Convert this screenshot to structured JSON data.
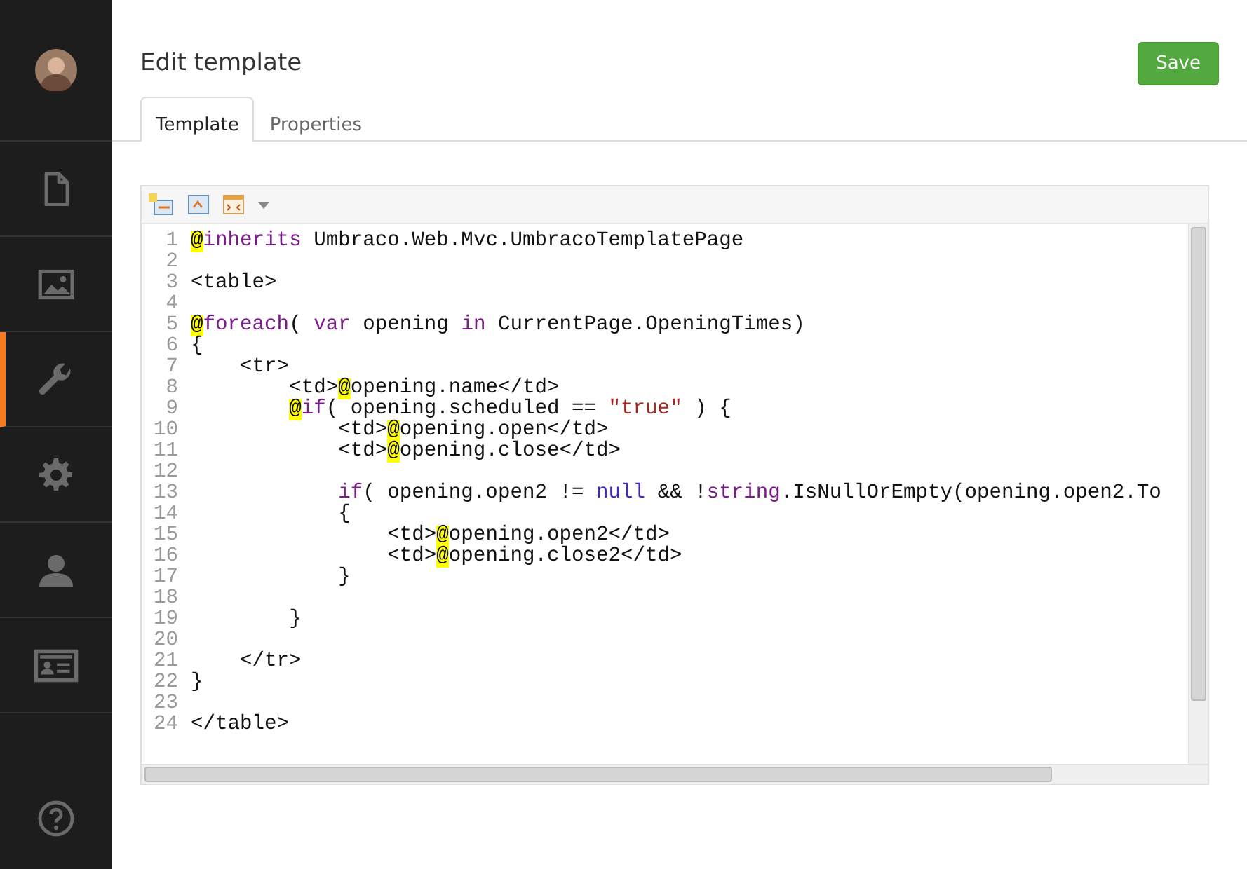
{
  "sidebar": {
    "sections": [
      {
        "kind": "content",
        "selected": false
      },
      {
        "kind": "media",
        "selected": false
      },
      {
        "kind": "settings",
        "selected": true
      },
      {
        "kind": "developer",
        "selected": false
      },
      {
        "kind": "users",
        "selected": false
      },
      {
        "kind": "members",
        "selected": false
      }
    ]
  },
  "header": {
    "title": "Edit template",
    "save_button": "Save"
  },
  "tabs": [
    {
      "label": "Template",
      "selected": true
    },
    {
      "label": "Properties",
      "selected": false
    }
  ],
  "editor": {
    "lines": [
      {
        "number": "1",
        "tokens": [
          {
            "kind": "at",
            "text": "@"
          },
          {
            "kind": "keyword",
            "text": "inherits"
          },
          {
            "kind": "plain",
            "text": " Umbraco.Web.Mvc.UmbracoTemplatePage"
          }
        ]
      },
      {
        "number": "2"
      },
      {
        "number": "3",
        "tokens": [
          {
            "kind": "plain",
            "text": "<table>"
          }
        ]
      },
      {
        "number": "4"
      },
      {
        "number": "5",
        "tokens": [
          {
            "kind": "at",
            "text": "@"
          },
          {
            "kind": "keyword",
            "text": "foreach"
          },
          {
            "kind": "plain",
            "text": "( "
          },
          {
            "kind": "keyword",
            "text": "var"
          },
          {
            "kind": "plain",
            "text": " opening "
          },
          {
            "kind": "keyword",
            "text": "in"
          },
          {
            "kind": "plain",
            "text": " CurrentPage.OpeningTimes)"
          }
        ]
      },
      {
        "number": "6",
        "tokens": [
          {
            "kind": "plain",
            "text": "{"
          }
        ]
      },
      {
        "number": "7",
        "tokens": [
          {
            "kind": "plain",
            "text": "    <tr>"
          }
        ]
      },
      {
        "number": "8",
        "tokens": [
          {
            "kind": "plain",
            "text": "        <td>"
          },
          {
            "kind": "at",
            "text": "@"
          },
          {
            "kind": "plain",
            "text": "opening.name</td>"
          }
        ]
      },
      {
        "number": "9",
        "tokens": [
          {
            "kind": "at",
            "text": "        @"
          },
          {
            "kind": "keyword",
            "text": "if"
          },
          {
            "kind": "plain",
            "text": "( opening.scheduled == "
          },
          {
            "kind": "string",
            "text": "\"true\""
          },
          {
            "kind": "plain",
            "text": " ) {"
          }
        ]
      },
      {
        "number": "10",
        "tokens": [
          {
            "kind": "plain",
            "text": "            <td>"
          },
          {
            "kind": "at",
            "text": "@"
          },
          {
            "kind": "plain",
            "text": "opening.open</td>"
          }
        ]
      },
      {
        "number": "11",
        "tokens": [
          {
            "kind": "plain",
            "text": "            <td>"
          },
          {
            "kind": "at",
            "text": "@"
          },
          {
            "kind": "plain",
            "text": "opening.close</td>"
          }
        ]
      },
      {
        "number": "12"
      },
      {
        "number": "13",
        "tokens": [
          {
            "kind": "keyword",
            "text": "            if"
          },
          {
            "kind": "plain",
            "text": "( opening.open2 != "
          },
          {
            "kind": "literal",
            "text": "null"
          },
          {
            "kind": "plain",
            "text": " && !"
          },
          {
            "kind": "keyword",
            "text": "string"
          },
          {
            "kind": "plain",
            "text": ".IsNullOrEmpty(opening.open2.To"
          }
        ]
      },
      {
        "number": "14",
        "tokens": [
          {
            "kind": "plain",
            "text": "            {"
          }
        ]
      },
      {
        "number": "15",
        "tokens": [
          {
            "kind": "plain",
            "text": "                <td>"
          },
          {
            "kind": "at",
            "text": "@"
          },
          {
            "kind": "plain",
            "text": "opening.open2</td>"
          }
        ]
      },
      {
        "number": "16",
        "tokens": [
          {
            "kind": "plain",
            "text": "                <td>"
          },
          {
            "kind": "at",
            "text": "@"
          },
          {
            "kind": "plain",
            "text": "opening.close2</td>"
          }
        ]
      },
      {
        "number": "17",
        "tokens": [
          {
            "kind": "plain",
            "text": "            }"
          }
        ]
      },
      {
        "number": "18"
      },
      {
        "number": "19",
        "tokens": [
          {
            "kind": "plain",
            "text": "        }"
          }
        ]
      },
      {
        "number": "20"
      },
      {
        "number": "21",
        "tokens": [
          {
            "kind": "plain",
            "text": "    </tr>"
          }
        ]
      },
      {
        "number": "22",
        "tokens": [
          {
            "kind": "plain",
            "text": "}"
          }
        ]
      },
      {
        "number": "23"
      },
      {
        "number": "24",
        "tokens": [
          {
            "kind": "plain",
            "text": "</table>"
          }
        ]
      }
    ]
  }
}
